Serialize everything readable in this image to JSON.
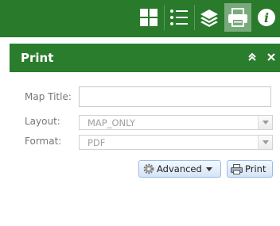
{
  "toolbar": {
    "buttons": [
      {
        "icon": "grid-icon"
      },
      {
        "icon": "list-icon"
      },
      {
        "icon": "layers-icon"
      },
      {
        "icon": "printer-icon",
        "active": true
      },
      {
        "icon": "info-icon"
      }
    ]
  },
  "panel": {
    "title": "Print",
    "collapse_icon": "double-chevron-up-icon",
    "close_icon": "close-icon"
  },
  "form": {
    "map_title_label": "Map Title:",
    "map_title_value": "",
    "layout_label": "Layout:",
    "layout_value": "MAP_ONLY",
    "format_label": "Format:",
    "format_value": "PDF"
  },
  "buttons": {
    "advanced_label": "Advanced",
    "print_label": "Print"
  },
  "colors": {
    "toolbar_bg": "#2a7a2c",
    "panel_header_bg": "#2b7d2e",
    "active_tool_bg": "#78aa7c"
  }
}
